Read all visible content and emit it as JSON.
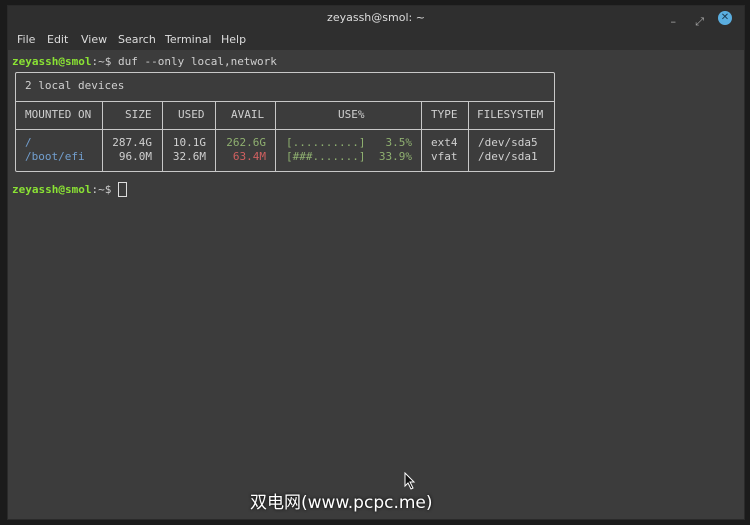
{
  "window": {
    "title": "zeyassh@smol: ~",
    "minimize": "–",
    "maximize": "⤢",
    "close": "✕"
  },
  "menu": [
    "File",
    "Edit",
    "View",
    "Search",
    "Terminal",
    "Help"
  ],
  "prompt": {
    "user_host": "zeyassh@smol",
    "path": ":~$",
    "command": " duf --only local,network"
  },
  "table": {
    "title": "2 local devices",
    "headers": [
      "MOUNTED ON",
      "SIZE",
      "USED",
      "AVAIL",
      "USE%",
      "TYPE",
      "FILESYSTEM"
    ],
    "rows": [
      {
        "mount": "/",
        "size": "287.4G",
        "used": "10.1G",
        "avail": "262.6G",
        "bar": "[..........]",
        "pct": "3.5%",
        "type": "ext4",
        "fs": "/dev/sda5"
      },
      {
        "mount": "/boot/efi",
        "size": "96.0M",
        "used": "32.6M",
        "avail": "63.4M",
        "bar": "[###.......]",
        "pct": "33.9%",
        "type": "vfat",
        "fs": "/dev/sda1"
      }
    ]
  },
  "watermark": "双电网(www.pcpc.me)"
}
